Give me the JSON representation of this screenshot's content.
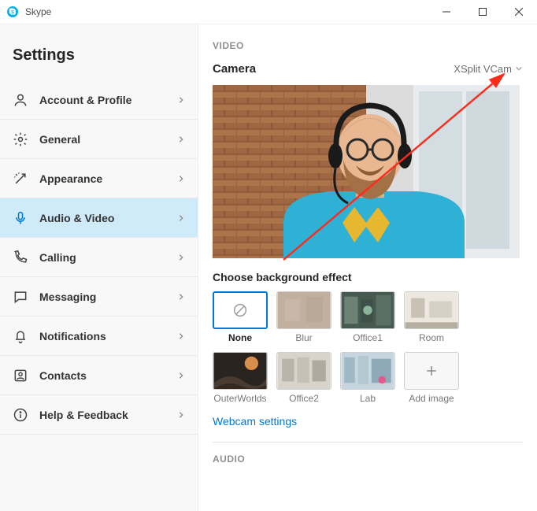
{
  "titlebar": {
    "app_name": "Skype"
  },
  "sidebar": {
    "title": "Settings",
    "items": [
      {
        "label": "Account & Profile",
        "active": false
      },
      {
        "label": "General",
        "active": false
      },
      {
        "label": "Appearance",
        "active": false
      },
      {
        "label": "Audio & Video",
        "active": true
      },
      {
        "label": "Calling",
        "active": false
      },
      {
        "label": "Messaging",
        "active": false
      },
      {
        "label": "Notifications",
        "active": false
      },
      {
        "label": "Contacts",
        "active": false
      },
      {
        "label": "Help & Feedback",
        "active": false
      }
    ]
  },
  "main": {
    "video_section_label": "VIDEO",
    "camera_label": "Camera",
    "camera_selected": "XSplit VCam",
    "background_heading": "Choose background effect",
    "effects": [
      {
        "label": "None",
        "selected": true
      },
      {
        "label": "Blur",
        "selected": false
      },
      {
        "label": "Office1",
        "selected": false
      },
      {
        "label": "Room",
        "selected": false
      },
      {
        "label": "OuterWorlds",
        "selected": false
      },
      {
        "label": "Office2",
        "selected": false
      },
      {
        "label": "Lab",
        "selected": false
      },
      {
        "label": "Add image",
        "selected": false
      }
    ],
    "webcam_settings_link": "Webcam settings",
    "audio_section_label": "AUDIO"
  }
}
